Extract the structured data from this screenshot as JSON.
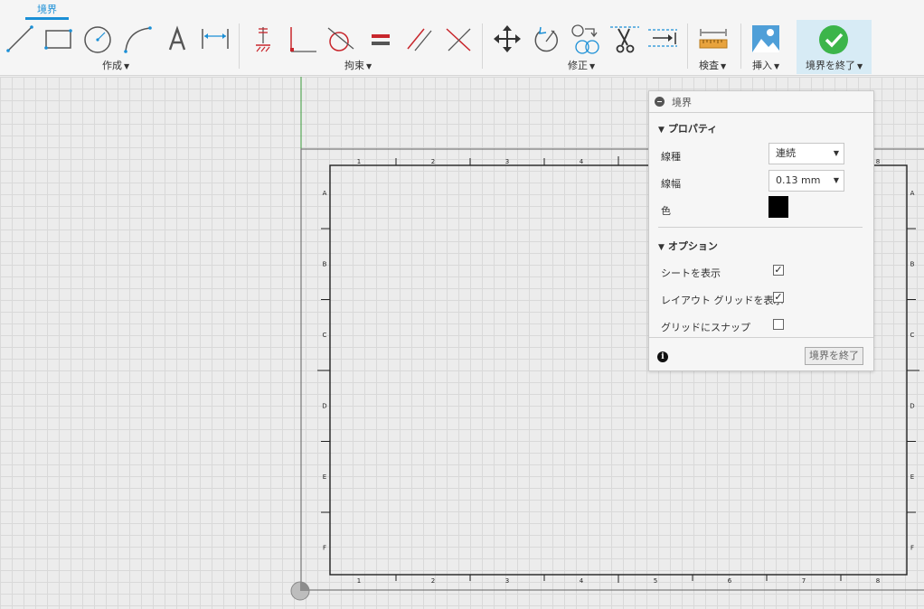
{
  "active_tab": "境界",
  "toolbar": {
    "groups": [
      {
        "label": "作成"
      },
      {
        "label": "拘束"
      },
      {
        "label": "修正"
      },
      {
        "label": "検査"
      },
      {
        "label": "挿入"
      },
      {
        "label": "境界を終了"
      }
    ]
  },
  "panel": {
    "title": "境界",
    "properties_header": "プロパティ",
    "line_type_label": "線種",
    "line_type_value": "連続",
    "line_width_label": "線幅",
    "line_width_value": "0.13 mm",
    "color_label": "色",
    "color_value": "#000000",
    "options_header": "オプション",
    "show_sheet_label": "シートを表示",
    "show_sheet_checked": true,
    "show_layout_grid_label": "レイアウト グリッドを表示",
    "show_layout_grid_checked": true,
    "snap_to_grid_label": "グリッドにスナップ",
    "snap_to_grid_checked": false,
    "finish_button": "境界を終了"
  },
  "sheet": {
    "column_labels": [
      "1",
      "2",
      "3",
      "4",
      "5",
      "6",
      "7",
      "8"
    ],
    "row_labels": [
      "A",
      "B",
      "C",
      "D",
      "E",
      "F"
    ]
  },
  "colors": {
    "accent": "#1a8fd6",
    "constraint_red": "#c8262c",
    "finish_green": "#3cb54a"
  }
}
